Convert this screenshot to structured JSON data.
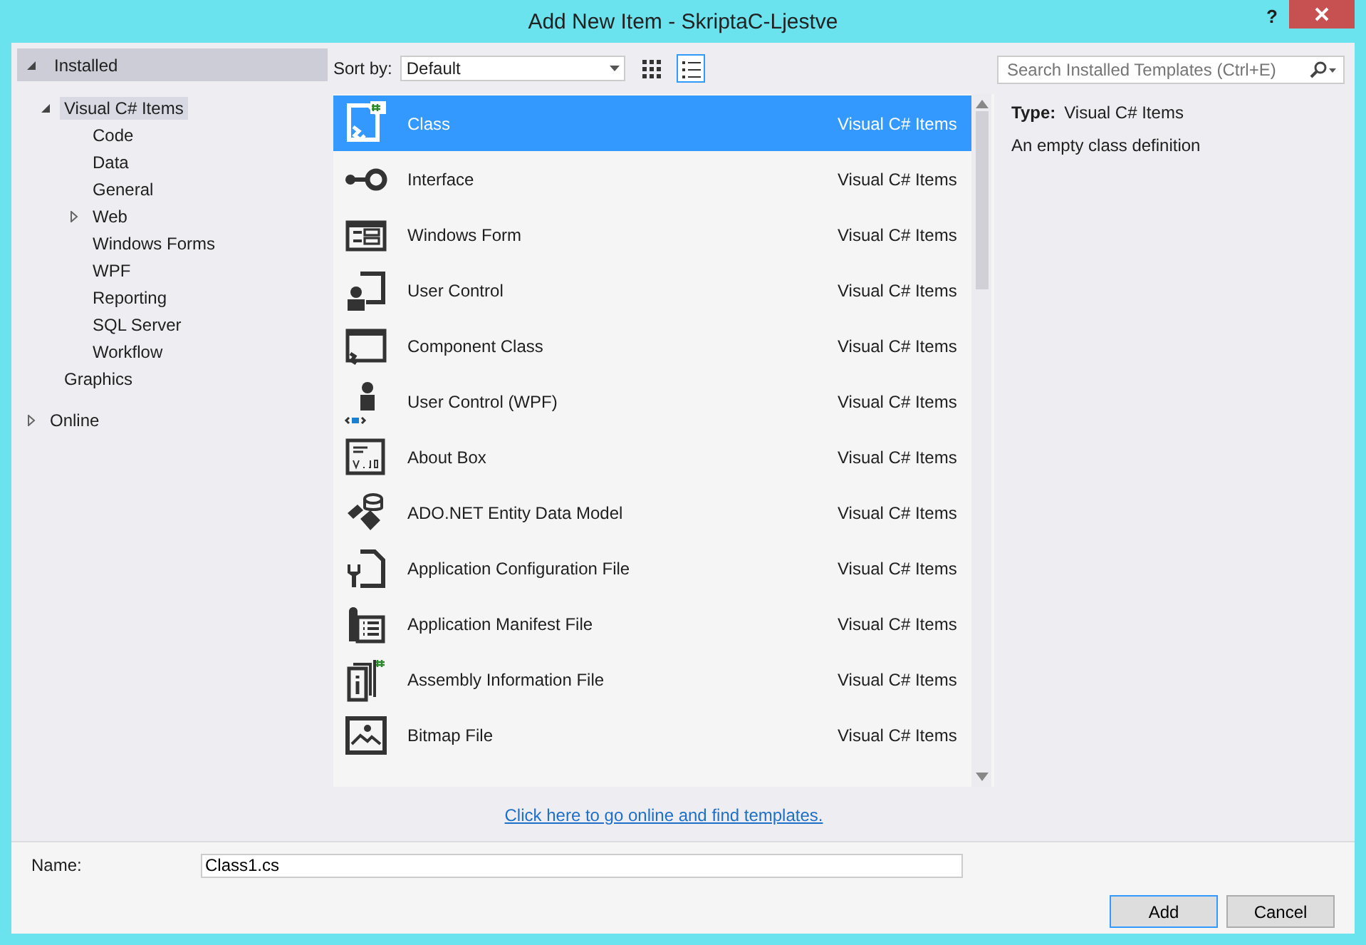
{
  "window": {
    "title": "Add New Item - SkriptaC-Ljestve",
    "help": "?"
  },
  "tree": {
    "header": {
      "label": "Installed",
      "expanded": true
    },
    "items": [
      {
        "label": "Visual C# Items",
        "expanded": true,
        "selected": true,
        "children": [
          {
            "label": "Code",
            "selected": false
          },
          {
            "label": "Data",
            "selected": false
          },
          {
            "label": "General",
            "selected": false
          },
          {
            "label": "Web",
            "expanded": false,
            "selected": false
          },
          {
            "label": "Windows Forms",
            "selected": false
          },
          {
            "label": "WPF",
            "selected": false
          },
          {
            "label": "Reporting",
            "selected": false
          },
          {
            "label": "SQL Server",
            "selected": false
          },
          {
            "label": "Workflow",
            "selected": false
          }
        ]
      },
      {
        "label": "Graphics",
        "selected": false
      }
    ],
    "sections": [
      {
        "label": "Online",
        "expanded": false
      }
    ]
  },
  "toolbar": {
    "sort_label": "Sort by:",
    "sort_value": "Default",
    "views": [
      {
        "kind": "grid",
        "selected": false
      },
      {
        "kind": "list",
        "selected": true
      }
    ]
  },
  "search": {
    "placeholder": "Search Installed Templates (Ctrl+E)"
  },
  "templates": [
    {
      "name": "Class",
      "type": "Visual C# Items",
      "selected": true
    },
    {
      "name": "Interface",
      "type": "Visual C# Items",
      "selected": false
    },
    {
      "name": "Windows Form",
      "type": "Visual C# Items",
      "selected": false
    },
    {
      "name": "User Control",
      "type": "Visual C# Items",
      "selected": false
    },
    {
      "name": "Component Class",
      "type": "Visual C# Items",
      "selected": false
    },
    {
      "name": "User Control (WPF)",
      "type": "Visual C# Items",
      "selected": false
    },
    {
      "name": "About Box",
      "type": "Visual C# Items",
      "selected": false
    },
    {
      "name": "ADO.NET Entity Data Model",
      "type": "Visual C# Items",
      "selected": false
    },
    {
      "name": "Application Configuration File",
      "type": "Visual C# Items",
      "selected": false
    },
    {
      "name": "Application Manifest File",
      "type": "Visual C# Items",
      "selected": false
    },
    {
      "name": "Assembly Information File",
      "type": "Visual C# Items",
      "selected": false
    },
    {
      "name": "Bitmap File",
      "type": "Visual C# Items",
      "selected": false
    }
  ],
  "online_link": "Click here to go online and find templates.",
  "details": {
    "type_label": "Type:",
    "type_value": "Visual C# Items",
    "description": "An empty class definition"
  },
  "name_field": {
    "label": "Name:",
    "value": "Class1.cs"
  },
  "buttons": [
    {
      "label": "Add",
      "kind": "default"
    },
    {
      "label": "Cancel",
      "kind": "normal"
    }
  ]
}
